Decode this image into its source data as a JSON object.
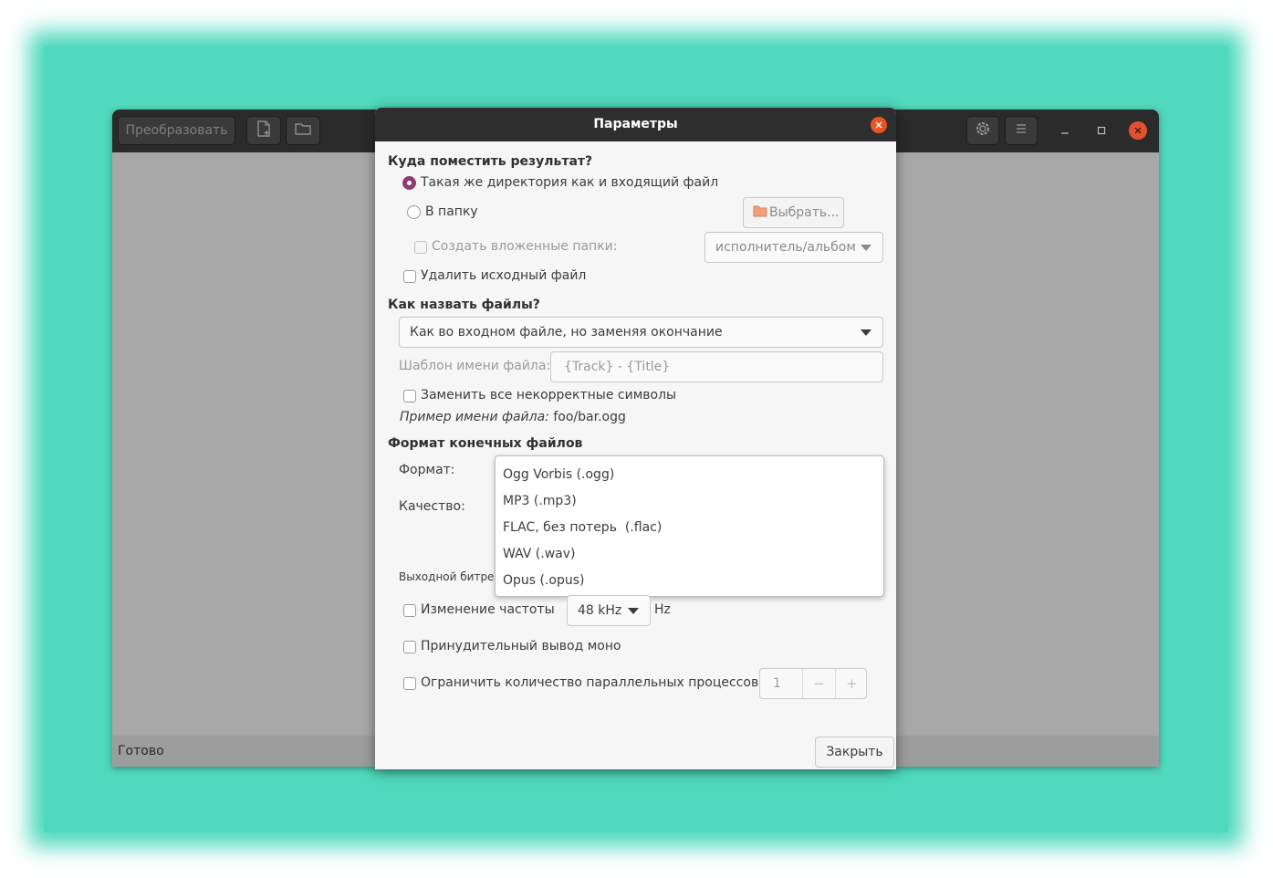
{
  "main_window": {
    "convert_button": "Преобразовать",
    "add_file_icon": "add-file-icon",
    "add_folder_icon": "add-folder-icon",
    "preferences_icon": "preferences-icon",
    "menu_icon": "hamburger-menu-icon",
    "status": "Готово"
  },
  "dialog": {
    "title": "Параметры",
    "where": {
      "heading": "Куда поместить результат?",
      "same_dir": "Такая же директория как и входящий файл",
      "to_folder": "В папку",
      "choose_button": "Выбрать...",
      "create_subfolders": "Создать вложенные папки:",
      "subfolder_pattern": "исполнитель/альбом",
      "delete_original": "Удалить исходный файл"
    },
    "naming": {
      "heading": "Как назвать файлы?",
      "scheme": "Как во входном файле, но заменяя окончание",
      "template_label": "Шаблон имени файла:",
      "template_placeholder": "{Track} - {Title}",
      "replace_invalid": "Заменить все некорректные символы",
      "example_label": "Пример имени файла:",
      "example_value": "foo/bar.ogg"
    },
    "format": {
      "heading": "Формат конечных файлов",
      "format_label": "Формат:",
      "quality_label": "Качество:",
      "bitrate_label": "Выходной битрейт",
      "options": [
        "Ogg Vorbis (.ogg)",
        "MP3 (.mp3)",
        "FLAC, без потерь  (.flac)",
        "WAV (.wav)",
        "Opus (.opus)"
      ],
      "resample_label": "Изменение частоты",
      "resample_value": "48 kHz",
      "resample_unit": "Hz",
      "force_mono": "Принудительный вывод моно",
      "limit_jobs": "Ограничить количество параллельных процессов",
      "jobs_value": "1",
      "minus": "−",
      "plus": "+"
    },
    "close_button": "Закрыть"
  },
  "colors": {
    "backdrop": "#50d9bc",
    "accent": "#8d3c73",
    "close": "#e95420"
  }
}
